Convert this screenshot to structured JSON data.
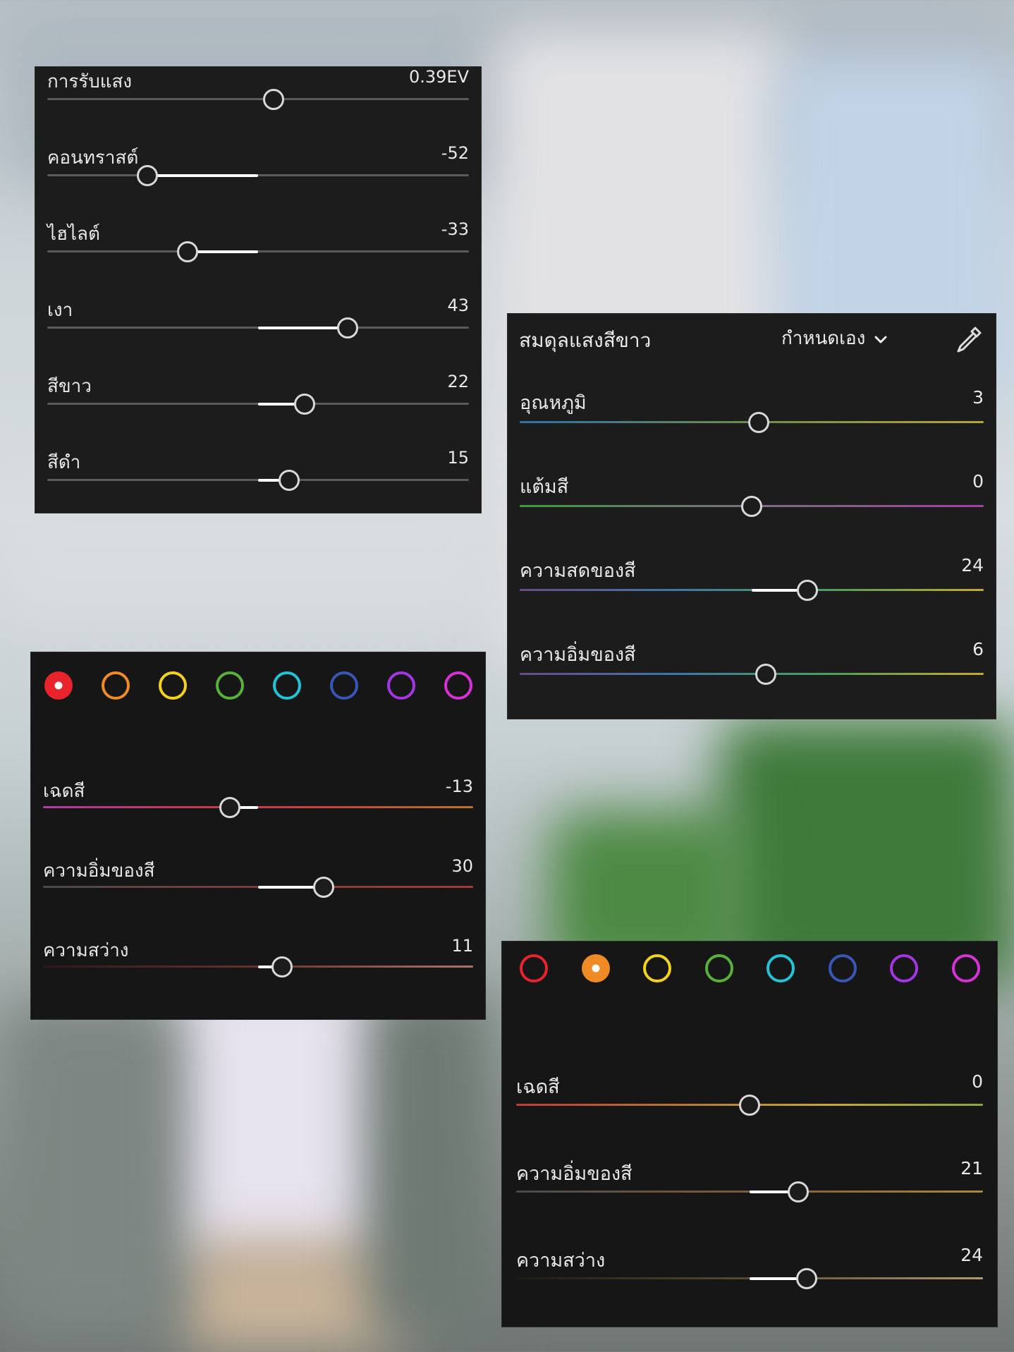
{
  "background": {
    "description_colors": [
      "#b9c2c8",
      "#4a7f3d",
      "#e8e4ee"
    ]
  },
  "light_panel": {
    "rows": [
      {
        "label": "การรับแสง",
        "value": "0.39EV"
      },
      {
        "label": "คอนทราสต์",
        "value": "-52"
      },
      {
        "label": "ไฮไลต์",
        "value": "-33"
      },
      {
        "label": "เงา",
        "value": "43"
      },
      {
        "label": "สีขาว",
        "value": "22"
      },
      {
        "label": "สีดำ",
        "value": "15"
      }
    ]
  },
  "wb_panel": {
    "title": "สมดุลแสงสีขาว",
    "mode": "กำหนดเอง",
    "mode_icon": "chevron-down-icon",
    "picker_icon": "eyedropper-icon",
    "rows": [
      {
        "label": "อุณหภูมิ",
        "value": "3"
      },
      {
        "label": "แต้มสี",
        "value": "0"
      },
      {
        "label": "ความสดของสี",
        "value": "24"
      },
      {
        "label": "ความอิ่มของสี",
        "value": "6"
      }
    ]
  },
  "mix_panel_red": {
    "selected_color": "red",
    "swatch_colors": [
      "#e8232b",
      "#f08a24",
      "#f2d21b",
      "#58b03a",
      "#22c3d6",
      "#3a55b8",
      "#a236e0",
      "#d631d4"
    ],
    "rows": [
      {
        "label": "เฉดสี",
        "value": "-13"
      },
      {
        "label": "ความอิ่มของสี",
        "value": "30"
      },
      {
        "label": "ความสว่าง",
        "value": "11"
      }
    ]
  },
  "mix_panel_orange": {
    "selected_color": "orange",
    "swatch_colors": [
      "#e8232b",
      "#f08a24",
      "#f2d21b",
      "#58b03a",
      "#22c3d6",
      "#3a55b8",
      "#a236e0",
      "#d631d4"
    ],
    "rows": [
      {
        "label": "เฉดสี",
        "value": "0"
      },
      {
        "label": "ความอิ่มของสี",
        "value": "21"
      },
      {
        "label": "ความสว่าง",
        "value": "24"
      }
    ]
  }
}
